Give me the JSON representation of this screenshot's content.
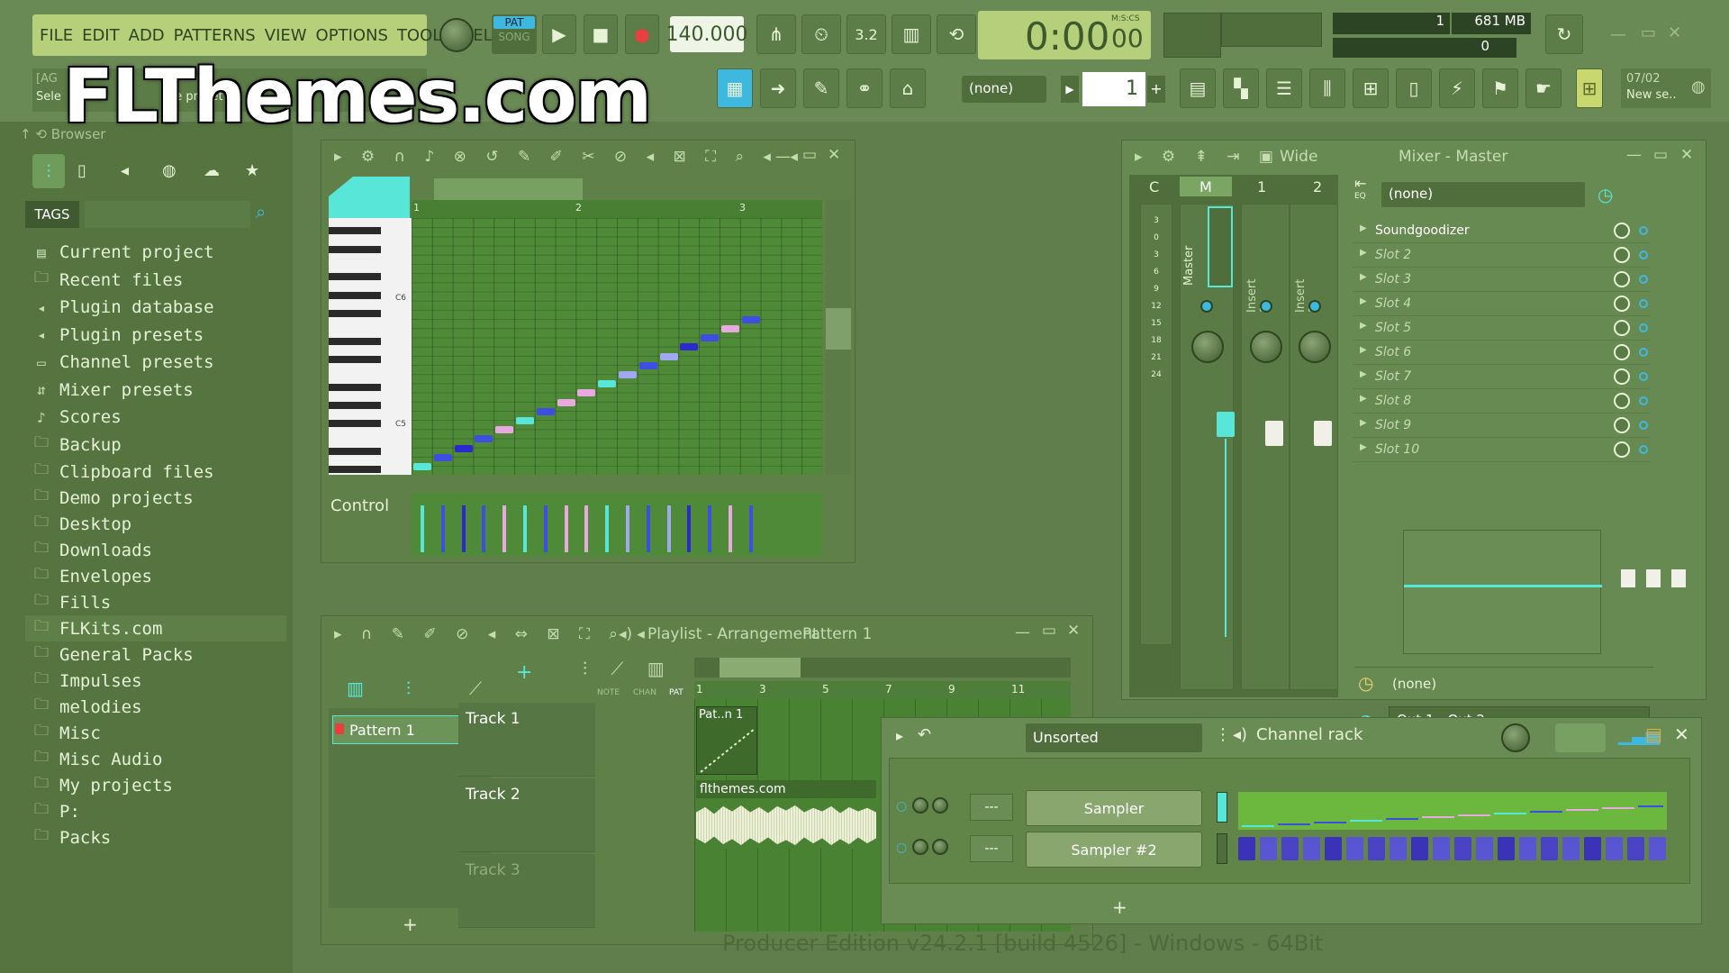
{
  "watermark": "FLThemes.com",
  "menu": [
    "FILE",
    "EDIT",
    "ADD",
    "PATTERNS",
    "VIEW",
    "OPTIONS",
    "TOOLS",
    "HELP"
  ],
  "transport": {
    "mode_pat": "PAT",
    "mode_song": "SONG",
    "tempo": "140.000",
    "time": "0:00",
    "time_small": "00",
    "time_label": "M:S:CS",
    "cpu_value": "1",
    "memory": "681 MB",
    "poly": "0",
    "pattern_selector": "(none)",
    "pattern_number": "1",
    "news_date": "07/02",
    "news_text": "New se.."
  },
  "hint": {
    "prefix": "[AG",
    "text": "Sele",
    "text2": "he preset"
  },
  "browser": {
    "title": "Browser",
    "tags_label": "TAGS",
    "items": [
      {
        "label": "Current project",
        "icon": "▤"
      },
      {
        "label": "Recent files",
        "icon": "🗀"
      },
      {
        "label": "Plugin database",
        "icon": "◂"
      },
      {
        "label": "Plugin presets",
        "icon": "◂"
      },
      {
        "label": "Channel presets",
        "icon": "▭"
      },
      {
        "label": "Mixer presets",
        "icon": "⇵"
      },
      {
        "label": "Scores",
        "icon": "♪"
      },
      {
        "label": "Backup",
        "icon": "🗀"
      },
      {
        "label": "Clipboard files",
        "icon": "🗀"
      },
      {
        "label": "Demo projects",
        "icon": "🗀"
      },
      {
        "label": "Desktop",
        "icon": "🗀"
      },
      {
        "label": "Downloads",
        "icon": "🗀"
      },
      {
        "label": "Envelopes",
        "icon": "🗀"
      },
      {
        "label": "Fills",
        "icon": "🗀"
      },
      {
        "label": "FLKits.com",
        "icon": "🗀"
      },
      {
        "label": "General Packs",
        "icon": "🗀"
      },
      {
        "label": "Impulses",
        "icon": "🗀"
      },
      {
        "label": "melodies",
        "icon": "🗀"
      },
      {
        "label": "Misc",
        "icon": "🗀"
      },
      {
        "label": "Misc Audio",
        "icon": "🗀"
      },
      {
        "label": "My projects",
        "icon": "🗀"
      },
      {
        "label": "P:",
        "icon": "🗀"
      },
      {
        "label": "Packs",
        "icon": "🗀"
      }
    ]
  },
  "piano_roll": {
    "bar_labels": [
      "1",
      "2",
      "3"
    ],
    "key_labels": [
      "C6",
      "C5"
    ],
    "control_label": "Control"
  },
  "mixer": {
    "title_mode": "Wide",
    "title": "Mixer - Master",
    "top_labels": [
      "C",
      "M",
      "1",
      "2"
    ],
    "strip_names": [
      "Master",
      "Insert 1",
      "Insert 2"
    ],
    "db_scale": [
      "3",
      "0",
      "3",
      "6",
      "9",
      "12",
      "15",
      "18",
      "21",
      "24"
    ],
    "preset": "(none)",
    "slots": [
      "Soundgoodizer",
      "Slot 2",
      "Slot 3",
      "Slot 4",
      "Slot 5",
      "Slot 6",
      "Slot 7",
      "Slot 8",
      "Slot 9",
      "Slot 10"
    ],
    "eq_label": "EQ",
    "send": "(none)",
    "output": "Out 1 - Out 2"
  },
  "playlist": {
    "title": "Playlist - Arrangement",
    "pattern": "Pattern 1",
    "pattern_item": "Pattern 1",
    "tabs": [
      "NOTE",
      "CHAN",
      "PAT"
    ],
    "ruler": [
      "1",
      "3",
      "5",
      "7",
      "9",
      "11"
    ],
    "tracks": [
      "Track 1",
      "Track 2",
      "Track 3"
    ],
    "clip_pattern": "Pat..n 1",
    "clip_audio": "flthemes.com"
  },
  "channel_rack": {
    "filter": "Unsorted",
    "title": "Channel rack",
    "channels": [
      {
        "name": "Sampler",
        "route": "---"
      },
      {
        "name": "Sampler #2",
        "route": "---"
      }
    ]
  },
  "footer": "Producer Edition v24.2.1 [build 4526] - Windows - 64Bit",
  "colors": {
    "accent_cyan": "#58e6d8",
    "note_blue": "#3e4ee0",
    "note_pink": "#e8a8e0",
    "step_purple": "#3a33b8"
  }
}
